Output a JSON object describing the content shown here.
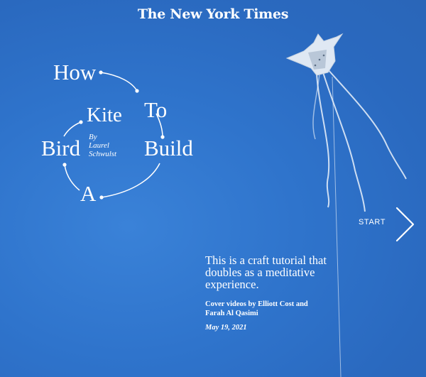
{
  "masthead": "The New York Times",
  "title_words": {
    "how": "How",
    "to": "To",
    "build": "Build",
    "a": "A",
    "bird": "Bird",
    "kite": "Kite"
  },
  "byline": {
    "by": "By",
    "author_line1": "Laurel",
    "author_line2": "Schwulst"
  },
  "start_label": "START",
  "intro": "This is a craft tutorial that doubles as a meditative experience.",
  "credits": "Cover videos by Elliott Cost and Farah Al Qasimi",
  "date": "May 19, 2021",
  "colors": {
    "sky": "#2f74cc",
    "text": "#ffffff"
  },
  "icons": {
    "next": "chevron-right-icon",
    "kite": "bird-kite-illustration"
  }
}
